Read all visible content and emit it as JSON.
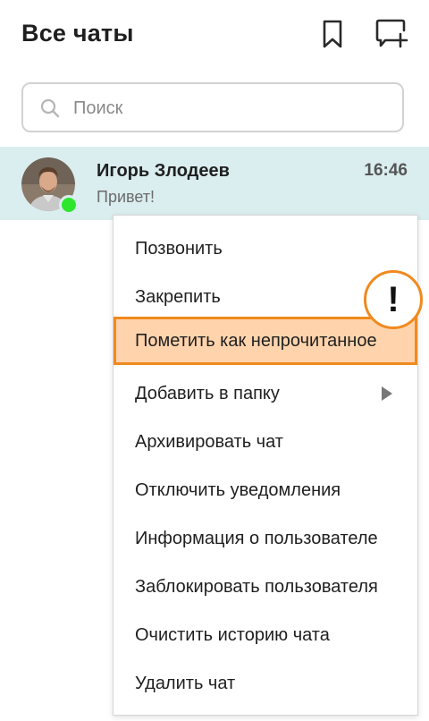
{
  "header": {
    "title": "Все чаты",
    "bookmark_icon": "bookmark-icon",
    "new_chat_icon": "new-chat-icon"
  },
  "search": {
    "placeholder": "Поиск",
    "value": "",
    "icon": "search-icon"
  },
  "chats": [
    {
      "name": "Игорь Злодеев",
      "preview": "Привет!",
      "time": "16:46",
      "online": true,
      "selected": true
    }
  ],
  "context_menu": {
    "items": [
      {
        "label": "Позвонить"
      },
      {
        "label": "Закрепить"
      },
      {
        "label": "Пометить как непрочитанное",
        "highlighted": true
      },
      {
        "label": "Добавить в папку",
        "has_submenu": true
      },
      {
        "label": "Архивировать чат"
      },
      {
        "label": "Отключить уведомления"
      },
      {
        "label": "Информация о пользователе"
      },
      {
        "label": "Заблокировать пользователя"
      },
      {
        "label": "Очистить историю чата"
      },
      {
        "label": "Удалить чат"
      }
    ]
  },
  "alert_badge": {
    "symbol": "!"
  },
  "colors": {
    "selected_row": "#daedef",
    "highlight_fill": "#ffd4ad",
    "highlight_border": "#f08a1f",
    "online": "#2ee62e"
  }
}
